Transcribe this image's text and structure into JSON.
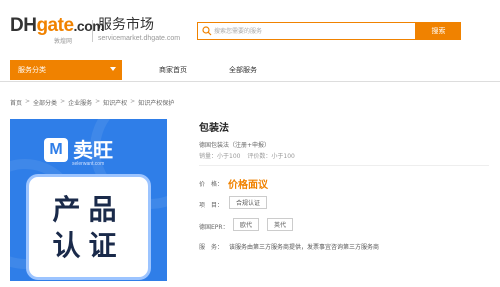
{
  "header": {
    "logo_dh": "DH",
    "logo_gate": "gate",
    "logo_com": ".com",
    "logo_sub": "敦煌网",
    "title": "服务市场",
    "domain": "servicemarket.dhgate.com",
    "search_placeholder": "搜索您需要的服务",
    "search_button": "搜索"
  },
  "nav": {
    "category": "服务分类",
    "links": [
      "商家首页",
      "全部服务"
    ]
  },
  "breadcrumb": [
    "首页",
    "全部分类",
    "企业服务",
    "知识产权",
    "知识产权保护"
  ],
  "product_image": {
    "brand": "卖旺",
    "brand_icon": "M",
    "brand_sub": "selerwant.com",
    "line1": "产品",
    "line2": "认证"
  },
  "product": {
    "title": "包装法",
    "subtitle": "德国包装法（注册+申报）",
    "stats": {
      "sales": "销量：小于100",
      "reviews": "评价数：小于100"
    },
    "price_label": "价　格：",
    "price_value": "价格面议",
    "item_label": "项　目：",
    "item_tag": "合规认证",
    "epr_label": "德国EPR：",
    "epr_tags": [
      "欧代",
      "英代"
    ],
    "service_label": "服　务：",
    "service_text": "该服务由第三方服务商提供，发票事宜咨询第三方服务商"
  },
  "colors": {
    "accent": "#f08200",
    "image_bg": "#2f7ee8"
  }
}
